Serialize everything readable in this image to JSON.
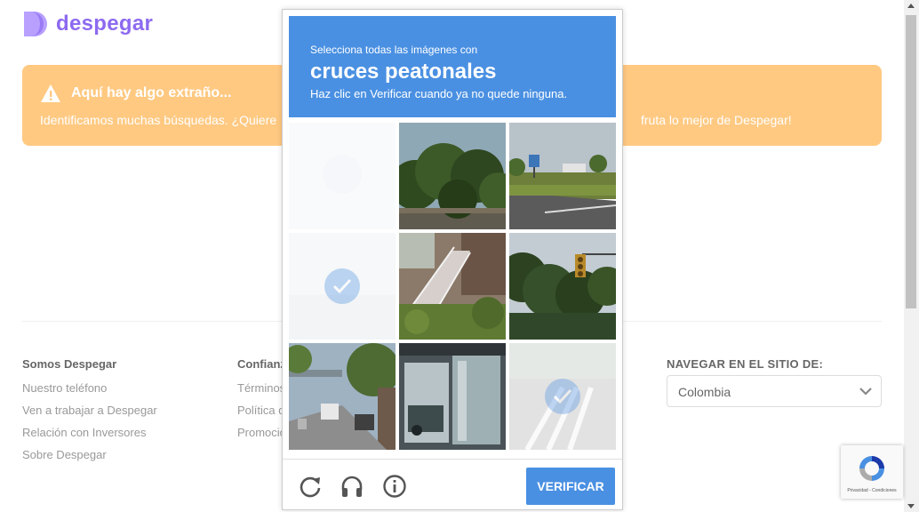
{
  "brand": {
    "name": "despegar",
    "color": "#8d6af0"
  },
  "alert": {
    "title": "Aquí hay algo extraño...",
    "body_start": "Identificamos muchas búsquedas. ¿Quiere",
    "body_end": "fruta lo mejor de Despegar!",
    "background": "#ffc982"
  },
  "footer": {
    "col1": {
      "heading": "Somos Despegar",
      "links": [
        "Nuestro teléfono",
        "Ven a trabajar a Despegar",
        "Relación con Inversores",
        "Sobre Despegar"
      ]
    },
    "col2": {
      "heading": "Confianz",
      "links": [
        "Términos",
        "Política d",
        "Promocio"
      ]
    },
    "nav": {
      "heading": "NAVEGAR EN EL SITIO DE:",
      "selected": "Colombia"
    }
  },
  "recaptcha_badge": {
    "terms": "Privacidad - Condiciones"
  },
  "challenge": {
    "instruction": "Selecciona todas las imágenes con",
    "target": "cruces peatonales",
    "hint": "Haz clic en Verificar cuando ya no quede ninguna.",
    "verify_label": "VERIFICAR",
    "accent": "#4a90e2",
    "tiles": [
      {
        "scene": "blank",
        "selected": true
      },
      {
        "scene": "trees",
        "selected": false
      },
      {
        "scene": "road-billboard",
        "selected": false
      },
      {
        "scene": "blank",
        "selected": true
      },
      {
        "scene": "stairs",
        "selected": false
      },
      {
        "scene": "traffic-light-trees",
        "selected": false
      },
      {
        "scene": "street-bridge",
        "selected": false
      },
      {
        "scene": "car-window",
        "selected": false
      },
      {
        "scene": "crosswalk",
        "selected": true
      }
    ],
    "icons": [
      "reload-icon",
      "headphones-icon",
      "info-icon"
    ]
  }
}
